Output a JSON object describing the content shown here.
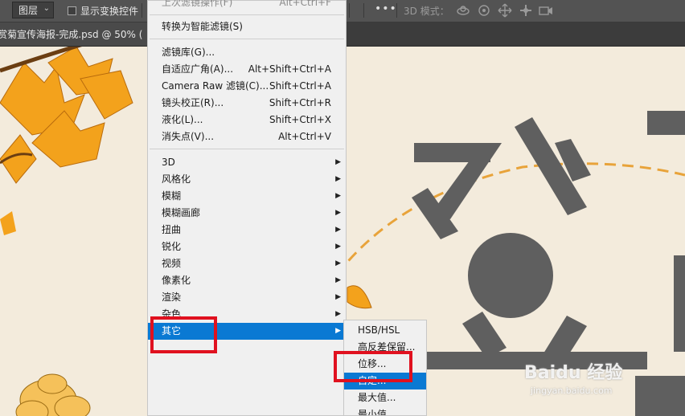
{
  "options_bar": {
    "layer_select_value": "图层",
    "show_transform_label": "显示变换控件",
    "more_label": "•••",
    "mode_3d_label": "3D 模式："
  },
  "document_tab": {
    "title": "赏菊宣传海报-完成.psd @ 50% ("
  },
  "filter_menu": {
    "last_filter": "上次滤镜操作(F)",
    "last_filter_shortcut": "Alt+Ctrl+F",
    "convert_smart": "转换为智能滤镜(S)",
    "items": [
      {
        "label": "滤镜库(G)...",
        "shortcut": ""
      },
      {
        "label": "自适应广角(A)...",
        "shortcut": "Alt+Shift+Ctrl+A"
      },
      {
        "label": "Camera Raw 滤镜(C)...",
        "shortcut": "Shift+Ctrl+A"
      },
      {
        "label": "镜头校正(R)...",
        "shortcut": "Shift+Ctrl+R"
      },
      {
        "label": "液化(L)...",
        "shortcut": "Shift+Ctrl+X"
      },
      {
        "label": "消失点(V)...",
        "shortcut": "Alt+Ctrl+V"
      }
    ],
    "submenus": [
      {
        "label": "3D"
      },
      {
        "label": "风格化"
      },
      {
        "label": "模糊"
      },
      {
        "label": "模糊画廊"
      },
      {
        "label": "扭曲"
      },
      {
        "label": "锐化"
      },
      {
        "label": "视频"
      },
      {
        "label": "像素化"
      },
      {
        "label": "渲染"
      },
      {
        "label": "杂色"
      },
      {
        "label": "其它"
      }
    ]
  },
  "other_submenu": {
    "items": [
      {
        "label": "HSB/HSL"
      },
      {
        "label": "高反差保留..."
      },
      {
        "label": "位移..."
      },
      {
        "label": "自定..."
      },
      {
        "label": "最大值..."
      },
      {
        "label": "最小值..."
      }
    ]
  },
  "watermark": {
    "brand": "Baidu 经验",
    "url": "jingyan.baidu.com"
  },
  "colors": {
    "highlight": "#0a79d3",
    "annotation_red": "#e0111f",
    "poster_bg": "#f3ebdc",
    "glyph_gray": "#5f5f5f",
    "leaf_orange": "#f3a21c"
  }
}
